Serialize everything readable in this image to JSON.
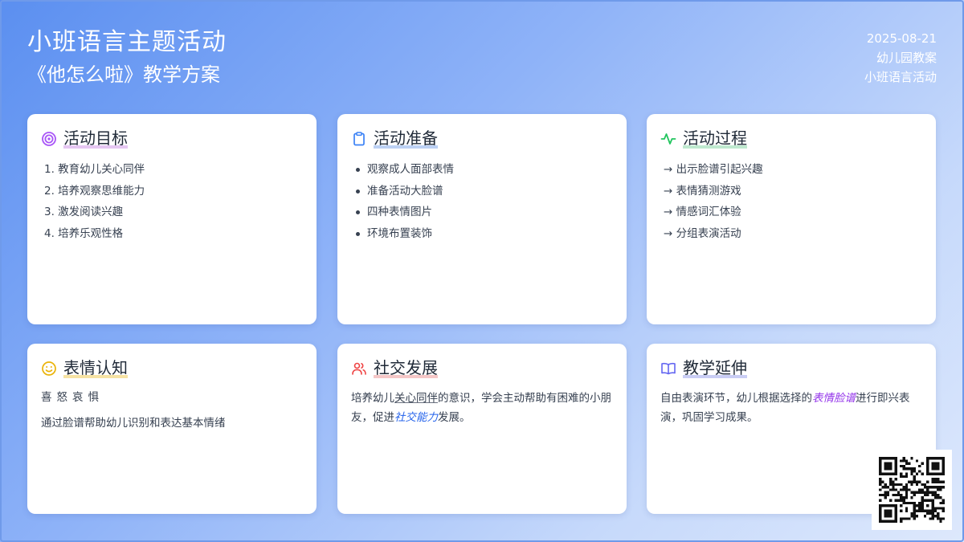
{
  "header": {
    "title": "小班语言主题活动",
    "subtitle": "《他怎么啦》教学方案",
    "date": "2025-08-21",
    "category": "幼儿园教案",
    "tag": "小班语言活动"
  },
  "cards": {
    "goals": {
      "icon": "target-icon",
      "color": "#a855f7",
      "title": "活动目标",
      "items": [
        "1. 教育幼儿关心同伴",
        "2. 培养观察思维能力",
        "3. 激发阅读兴趣",
        "4. 培养乐观性格"
      ]
    },
    "prep": {
      "icon": "clipboard-icon",
      "color": "#3b82f6",
      "title": "活动准备",
      "items": [
        "观察成人面部表情",
        "准备活动大脸谱",
        "四种表情图片",
        "环境布置装饰"
      ]
    },
    "process": {
      "icon": "activity-icon",
      "color": "#22c55e",
      "title": "活动过程",
      "items": [
        "→ 出示脸谱引起兴趣",
        "→ 表情猜测游戏",
        "→ 情感词汇体验",
        "→ 分组表演活动"
      ]
    },
    "emotion": {
      "icon": "smile-icon",
      "color": "#eab308",
      "title": "表情认知",
      "emotions": "喜怒哀惧",
      "text": "通过脸谱帮助幼儿识别和表达基本情绪"
    },
    "social": {
      "icon": "users-icon",
      "color": "#ef4444",
      "title": "社交发展",
      "text_1": "培养幼儿",
      "link_1": "关心同伴",
      "text_2": "的意识，学会主动帮助有困难的小朋友，促进",
      "em": "社交能力",
      "text_3": "发展。"
    },
    "extension": {
      "icon": "book-open-icon",
      "color": "#6366f1",
      "title": "教学延伸",
      "text_1": "自由表演环节，幼儿根据选择的",
      "em": "表情脸谱",
      "text_2": "进行即兴表演，巩固学习成果。"
    }
  },
  "qr": {
    "icon": "qr-code-icon"
  }
}
